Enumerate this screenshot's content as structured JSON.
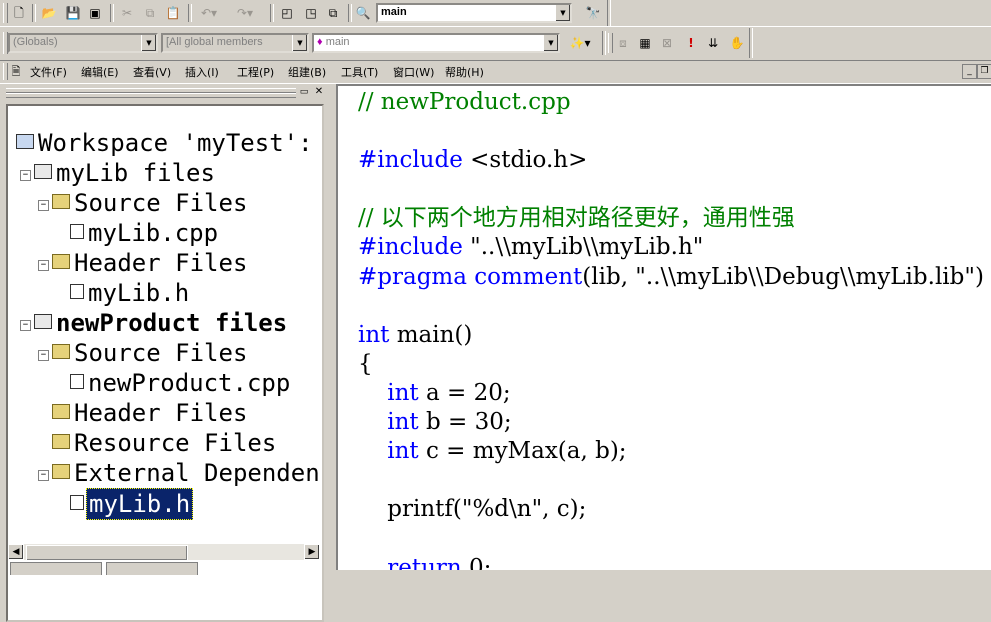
{
  "toolbar1": {
    "find_combo_value": "main",
    "icons": [
      "new-text-file-icon",
      "open-icon",
      "save-icon",
      "save-all-icon",
      "cut-icon",
      "copy-icon",
      "paste-icon",
      "undo-icon",
      "redo-icon",
      "workspace-icon",
      "output-icon",
      "window-list-icon",
      "find-in-files-icon",
      "find-icon"
    ]
  },
  "toolbar2": {
    "class_combo": "(Globals)",
    "filter_combo": "[All global members",
    "member_combo": "main",
    "icons": [
      "wizard-action-icon",
      "compile-icon",
      "build-icon",
      "stop-build-icon",
      "execute-icon",
      "go-icon",
      "breakpoint-icon"
    ]
  },
  "menu": {
    "items": [
      "文件(F)",
      "编辑(E)",
      "查看(V)",
      "插入(I)",
      "工程(P)",
      "组建(B)",
      "工具(T)",
      "窗口(W)",
      "帮助(H)"
    ]
  },
  "workspace": {
    "tree": [
      {
        "label": "Workspace 'myTest':",
        "icon": "workspace-icon"
      },
      {
        "label": "myLib files",
        "icon": "project-icon"
      },
      {
        "label": "Source Files",
        "icon": "folder-open-icon"
      },
      {
        "label": "myLib.cpp",
        "icon": "cpp-file-icon"
      },
      {
        "label": "Header Files",
        "icon": "folder-open-icon"
      },
      {
        "label": "myLib.h",
        "icon": "header-file-icon"
      },
      {
        "label": "newProduct files",
        "icon": "project-icon"
      },
      {
        "label": "Source Files",
        "icon": "folder-open-icon"
      },
      {
        "label": "newProduct.cpp",
        "icon": "cpp-file-icon"
      },
      {
        "label": "Header Files",
        "icon": "folder-icon"
      },
      {
        "label": "Resource Files",
        "icon": "folder-icon"
      },
      {
        "label": "External Dependen",
        "icon": "folder-open-icon"
      },
      {
        "label": "myLib.h",
        "icon": "header-file-icon"
      }
    ]
  },
  "editor": {
    "lines": [
      {
        "parts": [
          {
            "t": "// newProduct.cpp",
            "c": "com"
          }
        ]
      },
      {
        "parts": []
      },
      {
        "parts": [
          {
            "t": "#include",
            "c": "kw"
          },
          {
            "t": " <stdio.h>",
            "c": "txt"
          }
        ]
      },
      {
        "parts": []
      },
      {
        "parts": [
          {
            "t": "// 以下两个地方用相对路径更好，通用性强",
            "c": "com"
          }
        ]
      },
      {
        "parts": [
          {
            "t": "#include",
            "c": "kw"
          },
          {
            "t": " \"..\\\\myLib\\\\myLib.h\"",
            "c": "txt"
          }
        ]
      },
      {
        "parts": [
          {
            "t": "#pragma",
            "c": "kw"
          },
          {
            "t": " ",
            "c": "txt"
          },
          {
            "t": "comment",
            "c": "kw"
          },
          {
            "t": "(lib, \"..\\\\myLib\\\\Debug\\\\myLib.lib\")",
            "c": "txt"
          }
        ]
      },
      {
        "parts": []
      },
      {
        "parts": [
          {
            "t": "int",
            "c": "kw"
          },
          {
            "t": " main()",
            "c": "txt"
          }
        ]
      },
      {
        "parts": [
          {
            "t": "{",
            "c": "txt"
          }
        ]
      },
      {
        "parts": [
          {
            "t": "    ",
            "c": "txt"
          },
          {
            "t": "int",
            "c": "kw"
          },
          {
            "t": " a = 20;",
            "c": "txt"
          }
        ]
      },
      {
        "parts": [
          {
            "t": "    ",
            "c": "txt"
          },
          {
            "t": "int",
            "c": "kw"
          },
          {
            "t": " b = 30;",
            "c": "txt"
          }
        ]
      },
      {
        "parts": [
          {
            "t": "    ",
            "c": "txt"
          },
          {
            "t": "int",
            "c": "kw"
          },
          {
            "t": " c = myMax(a, b);",
            "c": "txt"
          }
        ]
      },
      {
        "parts": []
      },
      {
        "parts": [
          {
            "t": "    printf(\"%d\\n\", c);",
            "c": "txt"
          }
        ]
      },
      {
        "parts": []
      },
      {
        "parts": [
          {
            "t": "    ",
            "c": "txt"
          },
          {
            "t": "return",
            "c": "kw"
          },
          {
            "t": " 0;",
            "c": "txt"
          }
        ]
      }
    ]
  },
  "colors": {
    "comment": "#008000",
    "keyword": "#0000ff",
    "selection": "#0a246a",
    "chrome": "#d4d0c8"
  }
}
